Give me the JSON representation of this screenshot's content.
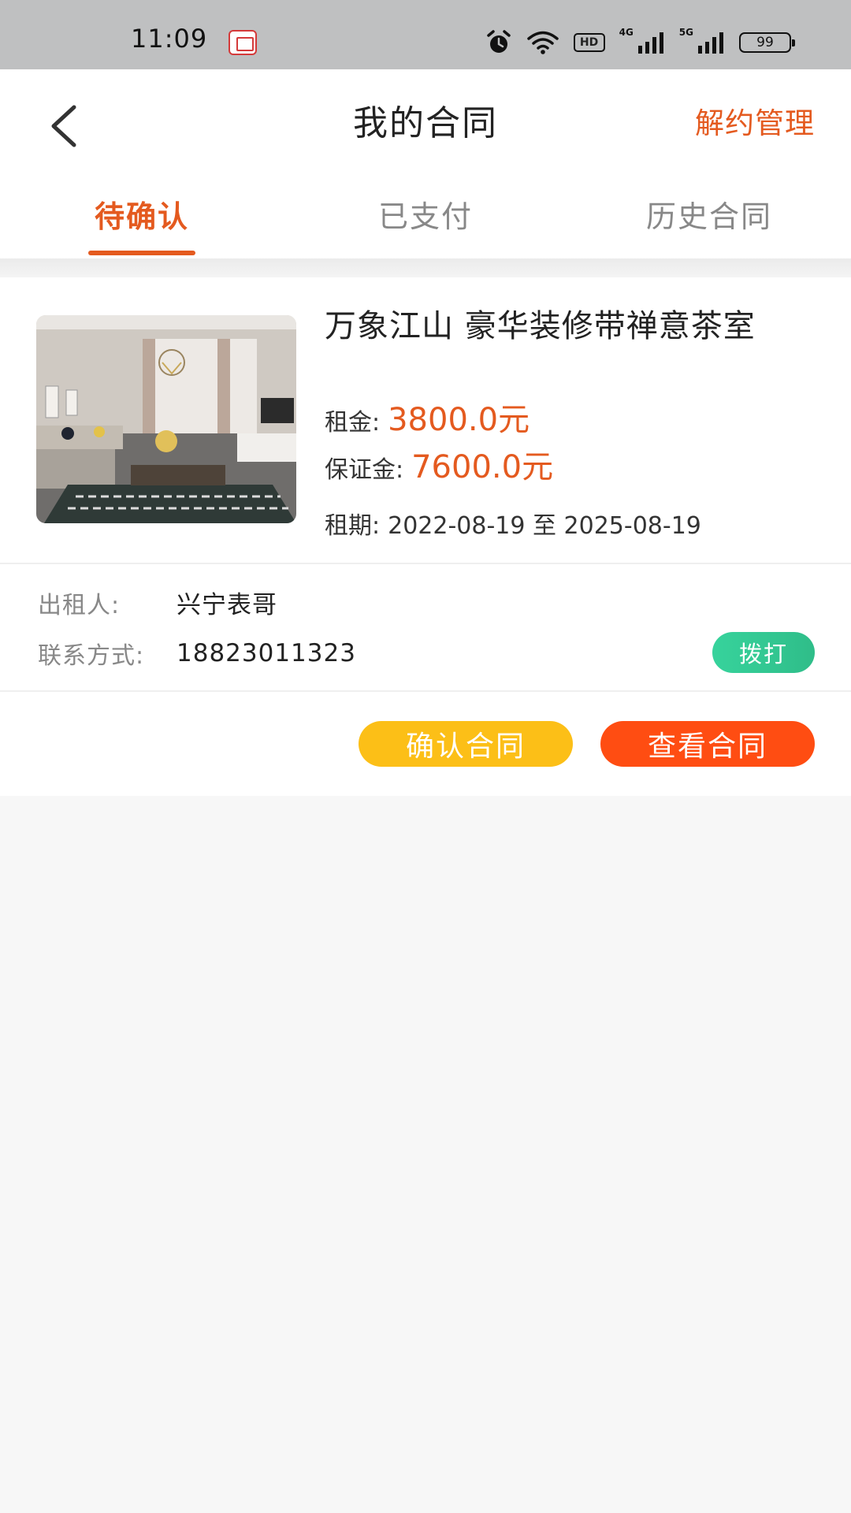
{
  "status_bar": {
    "time": "11:09",
    "icons": [
      "app-notification-icon",
      "alarm-icon",
      "wifi-icon",
      "hd-icon",
      "4g-signal-icon",
      "5g-signal-icon",
      "battery-icon"
    ],
    "hd_label": "HD",
    "signal_4g_label": "4G",
    "signal_5g_label": "5G",
    "battery_level": "99"
  },
  "header": {
    "back_icon": "chevron-left-icon",
    "title": "我的合同",
    "action_label": "解约管理",
    "accent_color": "#e45a1f"
  },
  "tabs": [
    {
      "label": "待确认",
      "active": true
    },
    {
      "label": "已支付",
      "active": false
    },
    {
      "label": "历史合同",
      "active": false
    }
  ],
  "contract": {
    "title": "万象江山 豪华装修带禅意茶室",
    "rent_label": "租金:",
    "rent_value": "3800.0元",
    "deposit_label": "保证金:",
    "deposit_value": "7600.0元",
    "term_label": "租期:",
    "term_value": "2022-08-19 至 2025-08-19",
    "landlord_label": "出租人:",
    "landlord_value": "兴宁表哥",
    "contact_label": "联系方式:",
    "contact_value": "18823011323",
    "call_label": "拨打",
    "confirm_label": "确认合同",
    "view_label": "查看合同",
    "colors": {
      "call": "#33c893",
      "confirm": "#fcbf17",
      "view": "#ff4d12"
    }
  }
}
